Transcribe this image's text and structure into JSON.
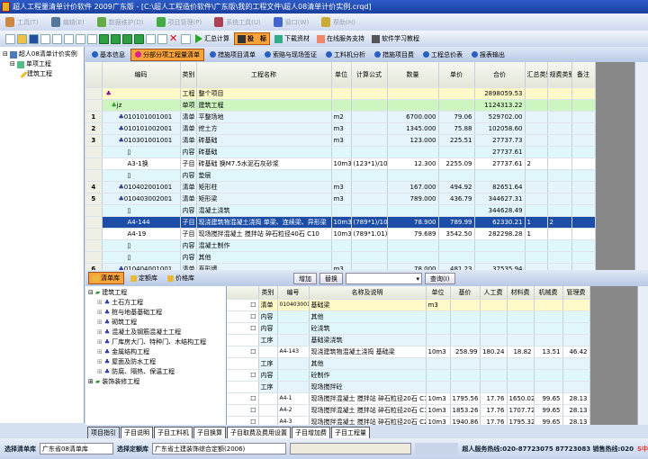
{
  "title": "超人工程量清单计价软件 2009广东版 - [C:\\超人工程造价软件\\广东版\\我的工程文件\\超人08清单计价实例.crqd]",
  "menu": [
    "工具(T)",
    "编辑(E)",
    "数据维护(D)",
    "项目管理(P)",
    "系统工具(U)",
    "窗口(W)",
    "帮助(H)"
  ],
  "toolbar": {
    "calc": "汇总计算",
    "analysis": "投　标",
    "download": "下载资材",
    "online": "在线服务支持",
    "tutorial": "软件学习教程"
  },
  "left_tree": [
    "超人08清单计价实例",
    "单项工程",
    "建筑工程"
  ],
  "tabs": [
    "基本信息",
    "分部分项工程量清单",
    "措施项目清单",
    "索赔与现场签证",
    "工料机分析",
    "措施项目费",
    "工程总价表",
    "报表输出"
  ],
  "main_grid": {
    "headers": [
      "编码",
      "类别",
      "工程名称",
      "单位",
      "计算公式",
      "数量",
      "单价",
      "合价",
      "汇总类别",
      "规费类别",
      "备注"
    ],
    "rows": [
      {
        "style": "yel",
        "n": "",
        "code": "",
        "type": "工程",
        "name": "整个项目",
        "bold": true,
        "unit": "",
        "formula": "",
        "qty": "",
        "price": "",
        "total": "2898059.53",
        "sum": "",
        "fee": "",
        "note": ""
      },
      {
        "style": "grn",
        "n": "",
        "code": "jz",
        "type": "单项",
        "name": "建筑工程",
        "bold": true,
        "unit": "",
        "formula": "",
        "qty": "",
        "price": "",
        "total": "1124313.22",
        "sum": "",
        "fee": "",
        "note": ""
      },
      {
        "style": "lb",
        "n": "1",
        "code": "010101001001",
        "type": "清单",
        "name": "平整场地",
        "unit": "m2",
        "formula": "",
        "qty": "6700.000",
        "price": "79.06",
        "total": "529702.00",
        "sum": "",
        "fee": "",
        "note": ""
      },
      {
        "style": "lb",
        "n": "2",
        "code": "010101002001",
        "type": "清单",
        "name": "挖土方",
        "unit": "m3",
        "formula": "",
        "qty": "1345.000",
        "price": "75.88",
        "total": "102058.60",
        "sum": "",
        "fee": "",
        "note": ""
      },
      {
        "style": "lb",
        "n": "3",
        "code": "010301001001",
        "type": "清单",
        "name": "砖基础",
        "unit": "m3",
        "formula": "",
        "qty": "123.000",
        "price": "225.51",
        "total": "27737.73",
        "sum": "",
        "fee": "",
        "note": ""
      },
      {
        "style": "cy",
        "n": "",
        "code": "",
        "type": "内容",
        "name": "砖基础",
        "bold": true,
        "unit": "",
        "formula": "",
        "qty": "",
        "price": "",
        "total": "27737.61",
        "sum": "",
        "fee": "",
        "note": ""
      },
      {
        "style": "wh",
        "n": "",
        "code": "A3-1换",
        "type": "子目",
        "name": "砖基础 换M7.5水泥石灰砂浆",
        "unit": "10m3",
        "formula": "(123*1)/10",
        "qty": "12.300",
        "price": "2255.09",
        "total": "27737.61",
        "sum": "2",
        "fee": "",
        "note": ""
      },
      {
        "style": "cy",
        "n": "",
        "code": "",
        "type": "内容",
        "name": "垫层",
        "bold": true,
        "unit": "",
        "formula": "",
        "qty": "",
        "price": "",
        "total": "",
        "sum": "",
        "fee": "",
        "note": ""
      },
      {
        "style": "lb",
        "n": "4",
        "code": "010402001001",
        "type": "清单",
        "name": "矩形柱",
        "unit": "m3",
        "formula": "",
        "qty": "167.000",
        "price": "494.92",
        "total": "82651.64",
        "sum": "",
        "fee": "",
        "note": ""
      },
      {
        "style": "lb",
        "n": "5",
        "code": "010403002001",
        "type": "清单",
        "name": "矩形梁",
        "unit": "m3",
        "formula": "",
        "qty": "789.000",
        "price": "436.79",
        "total": "344627.31",
        "sum": "",
        "fee": "",
        "note": ""
      },
      {
        "style": "cy",
        "n": "",
        "code": "",
        "type": "内容",
        "name": "混凝土浇筑",
        "bold": true,
        "unit": "",
        "formula": "",
        "qty": "",
        "price": "",
        "total": "344628.49",
        "sum": "",
        "fee": "",
        "note": ""
      },
      {
        "style": "sel",
        "n": "",
        "code": "A4-144",
        "type": "子目",
        "name": "现浇建筑物混凝土浇捣 单梁、连续梁、异形梁",
        "unit": "10m3",
        "formula": "(789*1)/10",
        "qty": "78.900",
        "price": "789.99",
        "total": "62330.21",
        "sum": "1",
        "fee": "2",
        "note": ""
      },
      {
        "style": "wh",
        "n": "",
        "code": "A4-19",
        "type": "子目",
        "name": "现场搅拌混凝土 搅拌站 碎石粒径40石 C10",
        "unit": "10m3",
        "formula": "(789*1.01)/10",
        "qty": "79.689",
        "price": "3542.50",
        "total": "282298.28",
        "sum": "1",
        "fee": "",
        "note": ""
      },
      {
        "style": "cy",
        "n": "",
        "code": "",
        "type": "内容",
        "name": "混凝土制作",
        "bold": true,
        "unit": "",
        "formula": "",
        "qty": "",
        "price": "",
        "total": "",
        "sum": "",
        "fee": "",
        "note": ""
      },
      {
        "style": "cy",
        "n": "",
        "code": "",
        "type": "内容",
        "name": "其他",
        "bold": true,
        "unit": "",
        "formula": "",
        "qty": "",
        "price": "",
        "total": "",
        "sum": "",
        "fee": "",
        "note": ""
      },
      {
        "style": "lb",
        "n": "6",
        "code": "010404001001",
        "type": "清单",
        "name": "直形墙",
        "unit": "m3",
        "formula": "",
        "qty": "78.000",
        "price": "481.23",
        "total": "37535.94",
        "sum": "",
        "fee": "",
        "note": ""
      }
    ]
  },
  "lib_tabs": [
    "清单库",
    "定额库",
    "价格库"
  ],
  "lib_buttons": {
    "add": "增加",
    "replace": "替换",
    "query": "查询(I)"
  },
  "lib_tree": {
    "root": "建筑工程",
    "items": [
      "土石方工程",
      "桩与地基基础工程",
      "砌筑工程",
      "混凝土及钢筋混凝土工程",
      "厂库房大门、特种门、木结构工程",
      "金属结构工程",
      "屋面及防水工程",
      "防腐、隔热、保温工程"
    ],
    "other": "装饰装修工程"
  },
  "lib_grid": {
    "headers": [
      "类别",
      "编号",
      "名称及说明",
      "单位",
      "基价",
      "人工费",
      "材料费",
      "机械费",
      "管理费"
    ],
    "rows": [
      {
        "style": "yel",
        "cb": true,
        "type": "清单",
        "code": "010403001",
        "name": "基础梁",
        "unit": "m3",
        "base": "",
        "labor": "",
        "mat": "",
        "mach": "",
        "mgmt": ""
      },
      {
        "style": "cy",
        "cb": true,
        "type": "内容",
        "code": "",
        "name": "其他",
        "unit": "",
        "base": "",
        "labor": "",
        "mat": "",
        "mach": "",
        "mgmt": ""
      },
      {
        "style": "cy",
        "cb": true,
        "type": "内容",
        "code": "",
        "name": "砼浇筑",
        "unit": "",
        "base": "",
        "labor": "",
        "mat": "",
        "mach": "",
        "mgmt": ""
      },
      {
        "style": "lb",
        "cb": false,
        "type": "工序",
        "code": "",
        "name": "基础梁浇筑",
        "unit": "",
        "base": "",
        "labor": "",
        "mat": "",
        "mach": "",
        "mgmt": ""
      },
      {
        "style": "wh",
        "cb": true,
        "type": "",
        "code": "A4-143",
        "name": "现浇建筑物混凝土浇捣 基础梁",
        "unit": "10m3",
        "base": "258.99",
        "labor": "180.24",
        "mat": "18.82",
        "mach": "13.51",
        "mgmt": "46.42"
      },
      {
        "style": "lb",
        "cb": false,
        "type": "工序",
        "code": "",
        "name": "其他",
        "unit": "",
        "base": "",
        "labor": "",
        "mat": "",
        "mach": "",
        "mgmt": ""
      },
      {
        "style": "cy",
        "cb": true,
        "type": "内容",
        "code": "",
        "name": "砼制作",
        "unit": "",
        "base": "",
        "labor": "",
        "mat": "",
        "mach": "",
        "mgmt": ""
      },
      {
        "style": "lb",
        "cb": false,
        "type": "工序",
        "code": "",
        "name": "现场搅拌砼",
        "unit": "",
        "base": "",
        "labor": "",
        "mat": "",
        "mach": "",
        "mgmt": ""
      },
      {
        "style": "wh",
        "cb": true,
        "type": "",
        "code": "A4-1",
        "name": "现场搅拌混凝土 搅拌站 碎石粒径20石 C10",
        "unit": "10m3",
        "base": "1795.56",
        "labor": "17.76",
        "mat": "1650.02",
        "mach": "99.65",
        "mgmt": "28.13"
      },
      {
        "style": "wh",
        "cb": true,
        "type": "",
        "code": "A4-2",
        "name": "现场搅拌混凝土 搅拌站 碎石粒径20石 C15",
        "unit": "10m3",
        "base": "1853.26",
        "labor": "17.76",
        "mat": "1707.72",
        "mach": "99.65",
        "mgmt": "28.13"
      },
      {
        "style": "wh",
        "cb": true,
        "type": "",
        "code": "A4-3",
        "name": "现场搅拌混凝土 搅拌站 碎石粒径20石 C20",
        "unit": "10m3",
        "base": "1940.86",
        "labor": "17.76",
        "mat": "1795.32",
        "mach": "99.65",
        "mgmt": "28.13"
      }
    ]
  },
  "bottom_tabs": [
    "项目指引",
    "子目说明",
    "子目工料机",
    "子目换算",
    "子目取费及费用设置",
    "子目增加费",
    "子目工程量"
  ],
  "status": {
    "list_lib_label": "选择清单库",
    "list_lib": "广东省08清单库",
    "quota_lib_label": "选择定额库",
    "quota_lib": "广东省土建装饰综合定额(2006)",
    "hotline": "超人服务热线:020-87723075 87723083 销售热线:020"
  }
}
